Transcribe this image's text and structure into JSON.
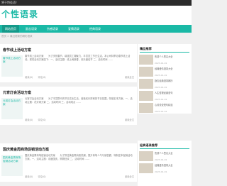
{
  "topbar": {
    "text": "将于特佳语！"
  },
  "header": {
    "logo": "个性语录"
  },
  "nav": {
    "items": [
      {
        "label": "网站首页"
      },
      {
        "label": "励志语录"
      },
      {
        "label": "伤感语录"
      },
      {
        "label": "爱情语录"
      },
      {
        "label": "经典语录"
      }
    ]
  },
  "breadcrumb": "首页 > 最近更新的精彩语录",
  "posts": [
    {
      "title": "春节线上活动方案",
      "thumb": "春节线上活动方案",
      "excerpt": "春节线上活动方案　　为了庆祝春节，增强员工凝聚力，丰富员工节日生活，本公司特举办春节线上活动。现将活动方案如下：一、活动主题：线上闹新春，欢乐度佳节 二、活动时间 ……",
      "meta": {
        "views": "阅读(0)",
        "comments": "评论(0)"
      },
      "more": "阅读全文"
    },
    {
      "title": "元宵灯会活动方案",
      "thumb": "元宵灯会活动方案",
      "excerpt": "元宵灯会活动方案　　为了丰富群众的节日文化生活，营造欢乐祥和的节日氛围，特制定本方案。一、活动主题：花灯闹元宵 二、活动时间 三、活动地点 ……",
      "meta": {
        "views": "阅读(0)",
        "comments": "评论(0)"
      },
      "more": "阅读全文"
    },
    {
      "title": "国庆黄金周商场促销活动方案",
      "thumb": "国庆黄金周商场促销活动方案",
      "excerpt": "国庆黄金周商场促销活动方案　　为了抓住黄金周消费热潮，提升商场人气与销售额，特制定本促销活动方案。一、活动主题：欢度国庆，购物狂欢 二、活动时间 ……",
      "meta": {
        "views": "阅读(0)",
        "comments": "评论(0)"
      },
      "more": "阅读全文"
    }
  ],
  "sidebar": {
    "widgets": [
      {
        "title": "精品推荐",
        "items": [
          {
            "text": "伤感个人签名大全",
            "date": "2023-01-01"
          },
          {
            "text": "经典爱情语录大全",
            "date": "2023-01-01"
          },
          {
            "text": "励志经典语录摘抄",
            "date": "2023-01-01"
          },
          {
            "text": "人生哲理经典语句",
            "date": "2023-01-01"
          },
          {
            "text": "心情说说短句精选",
            "date": "2023-01-01"
          }
        ]
      },
      {
        "title": "经典语录推荐",
        "items": [
          {
            "text": "伤感个人签名大全",
            "date": "2023-01-01"
          },
          {
            "text": "经典爱情语录大全",
            "date": "2023-01-01"
          }
        ]
      }
    ]
  }
}
